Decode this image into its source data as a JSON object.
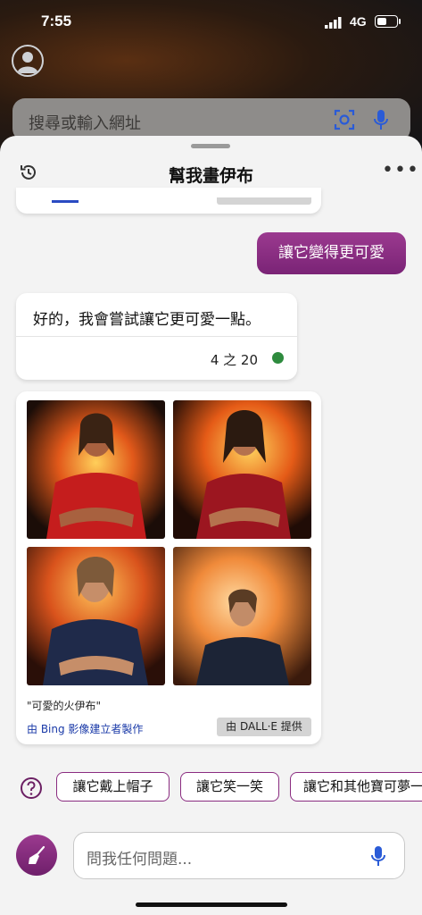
{
  "status": {
    "time": "7:55",
    "network": "4G",
    "battery_level": 0.5
  },
  "browser": {
    "search_placeholder": "搜尋或輸入網址"
  },
  "chat": {
    "title": "幫我畫伊布",
    "user_message": "讓它變得更可愛",
    "bot_message": "好的，我會嘗試讓它更可愛一點。",
    "turn_count": "4 之 20",
    "turn_indicator_color": "#2e8b3e",
    "image_card": {
      "caption": "\"可愛的火伊布\"",
      "made_by": "由 Bing 影像建立者製作",
      "provided_by": "由 DALL·E 提供"
    },
    "suggestions": [
      "讓它戴上帽子",
      "讓它笑一笑",
      "讓它和其他寶可夢一"
    ],
    "ask_placeholder": "問我任何問題..."
  },
  "colors": {
    "accent": "#8a2c80",
    "link": "#1a3aa8"
  },
  "icons": [
    "history-icon",
    "more-icon",
    "question-icon",
    "broom-icon",
    "mic-icon",
    "lens-icon",
    "profile-icon"
  ]
}
